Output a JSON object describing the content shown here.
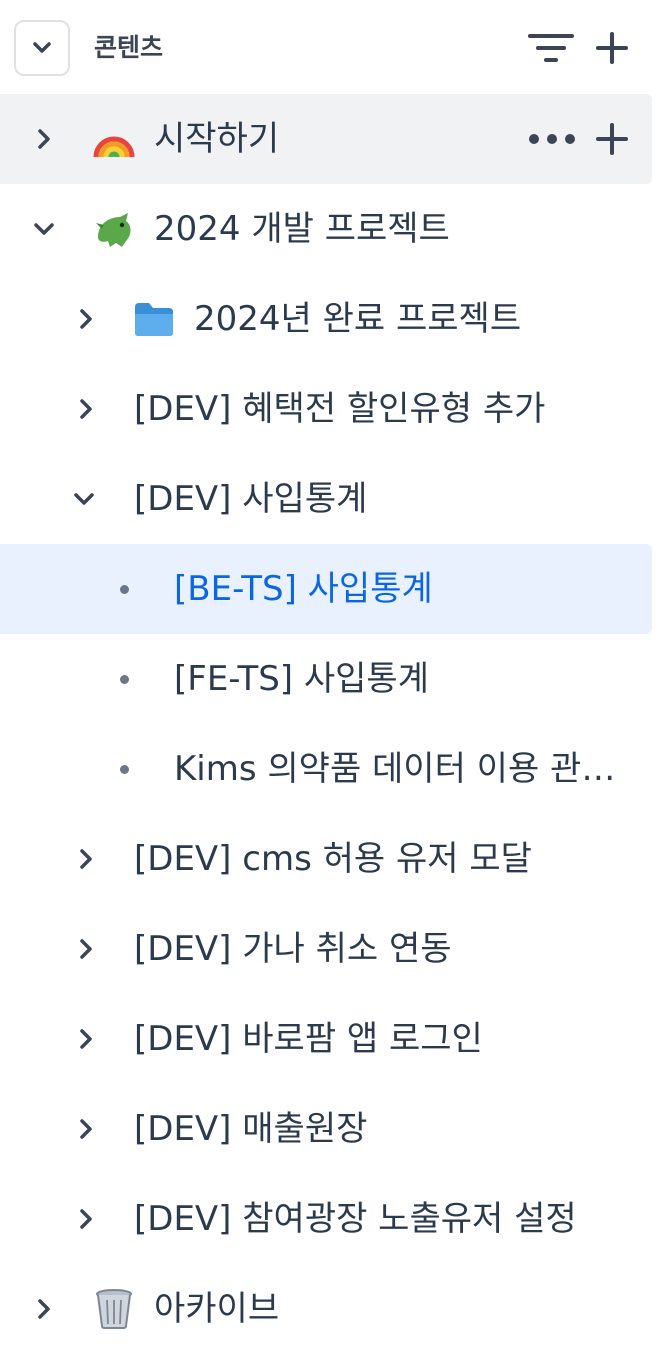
{
  "header": {
    "title": "콘텐츠",
    "collapse_icon": "chevron-down-icon",
    "filter_icon": "filter-icon",
    "add_icon": "plus-icon"
  },
  "colors": {
    "text": "#2c3a4d",
    "selected_text": "#0c66e4",
    "selected_bg": "#e8f1fd",
    "hover_bg": "#f1f2f4",
    "icon": "#3b4556"
  },
  "tree": [
    {
      "label": "시작하기",
      "emoji": "rainbow",
      "expanded": false,
      "hovered": true
    },
    {
      "label": "2024 개발 프로젝트",
      "emoji": "dragon",
      "expanded": true
    },
    {
      "label": "2024년 완료 프로젝트",
      "emoji": "folder",
      "expanded": false
    },
    {
      "label": "[DEV] 혜택전 할인유형 추가",
      "expanded": false
    },
    {
      "label": "[DEV] 사입통계",
      "expanded": true
    },
    {
      "label": "[BE-TS] 사입통계",
      "selected": true
    },
    {
      "label": "[FE-TS] 사입통계"
    },
    {
      "label": "Kims 의약품 데이터 이용 관…"
    },
    {
      "label": "[DEV] cms 허용 유저 모달",
      "expanded": false
    },
    {
      "label": "[DEV] 가나 취소 연동",
      "expanded": false
    },
    {
      "label": "[DEV] 바로팜 앱 로그인",
      "expanded": false
    },
    {
      "label": "[DEV] 매출원장",
      "expanded": false
    },
    {
      "label": "[DEV] 참여광장 노출유저 설정",
      "expanded": false
    },
    {
      "label": "아카이브",
      "emoji": "wastebasket",
      "expanded": false
    }
  ]
}
